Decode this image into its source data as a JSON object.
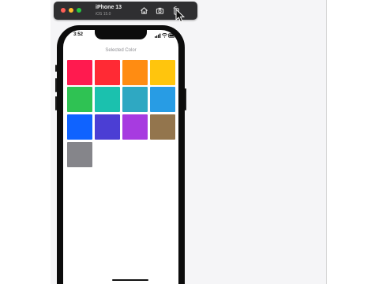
{
  "simulator": {
    "device_name": "iPhone 13",
    "os_version": "iOS 15.0",
    "toolbar_icons": [
      "home-icon",
      "screenshot-icon",
      "rotate-icon"
    ]
  },
  "status_bar": {
    "time": "3:52",
    "icons": [
      "signal-icon",
      "wifi-icon",
      "battery-icon"
    ]
  },
  "app": {
    "heading": "Selected Color",
    "colors": [
      {
        "name": "pink",
        "hex": "#ff1a4f"
      },
      {
        "name": "red",
        "hex": "#ff2a34"
      },
      {
        "name": "orange",
        "hex": "#ff8c12"
      },
      {
        "name": "yellow",
        "hex": "#ffc50d"
      },
      {
        "name": "green",
        "hex": "#2fc253"
      },
      {
        "name": "mint",
        "hex": "#1bc1ae"
      },
      {
        "name": "teal",
        "hex": "#2fa8c2"
      },
      {
        "name": "cyan",
        "hex": "#289ce4"
      },
      {
        "name": "blue",
        "hex": "#0f63ff"
      },
      {
        "name": "indigo",
        "hex": "#4b3ed4"
      },
      {
        "name": "purple",
        "hex": "#a73be0"
      },
      {
        "name": "brown",
        "hex": "#93754d"
      },
      {
        "name": "gray",
        "hex": "#85858a"
      }
    ]
  }
}
